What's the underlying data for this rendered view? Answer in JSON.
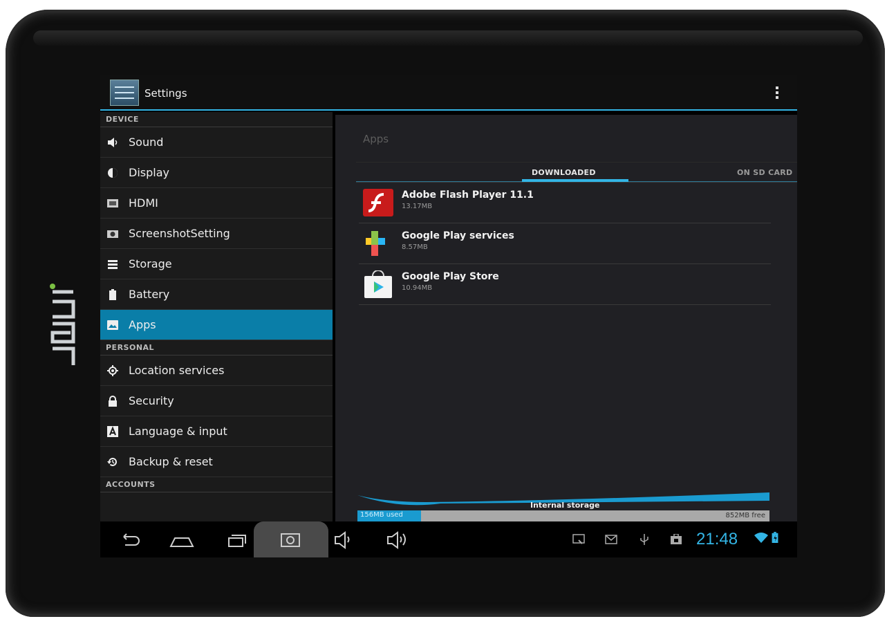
{
  "action_bar": {
    "title": "Settings"
  },
  "sidebar": {
    "sections": [
      {
        "header": "DEVICE",
        "items": [
          {
            "label": "Sound",
            "icon": "sound-icon"
          },
          {
            "label": "Display",
            "icon": "display-icon"
          },
          {
            "label": "HDMI",
            "icon": "hdmi-icon"
          },
          {
            "label": "ScreenshotSetting",
            "icon": "camera-icon"
          },
          {
            "label": "Storage",
            "icon": "storage-icon"
          },
          {
            "label": "Battery",
            "icon": "battery-icon"
          },
          {
            "label": "Apps",
            "icon": "apps-icon",
            "selected": true
          }
        ]
      },
      {
        "header": "PERSONAL",
        "items": [
          {
            "label": "Location services",
            "icon": "location-icon"
          },
          {
            "label": "Security",
            "icon": "lock-icon"
          },
          {
            "label": "Language & input",
            "icon": "keyboard-icon"
          },
          {
            "label": "Backup & reset",
            "icon": "backup-icon"
          }
        ]
      },
      {
        "header": "ACCOUNTS",
        "items": []
      }
    ]
  },
  "main": {
    "title": "Apps",
    "tabs": [
      {
        "label": "DOWNLOADED",
        "active": true
      },
      {
        "label": "ON SD CARD",
        "active": false
      }
    ],
    "apps": [
      {
        "name": "Adobe Flash Player 11.1",
        "size": "13.17MB",
        "icon": "flash-player-icon"
      },
      {
        "name": "Google Play services",
        "size": "8.57MB",
        "icon": "play-services-icon"
      },
      {
        "name": "Google Play Store",
        "size": "10.94MB",
        "icon": "play-store-icon"
      }
    ],
    "storage": {
      "label": "Internal storage",
      "used": "156MB used",
      "free": "852MB free",
      "used_fraction": 0.155
    }
  },
  "navbar": {
    "clock": "21:48"
  },
  "colors": {
    "accent": "#33b5e5",
    "selected": "#0a7ea8",
    "clock": "#33b5e5"
  }
}
